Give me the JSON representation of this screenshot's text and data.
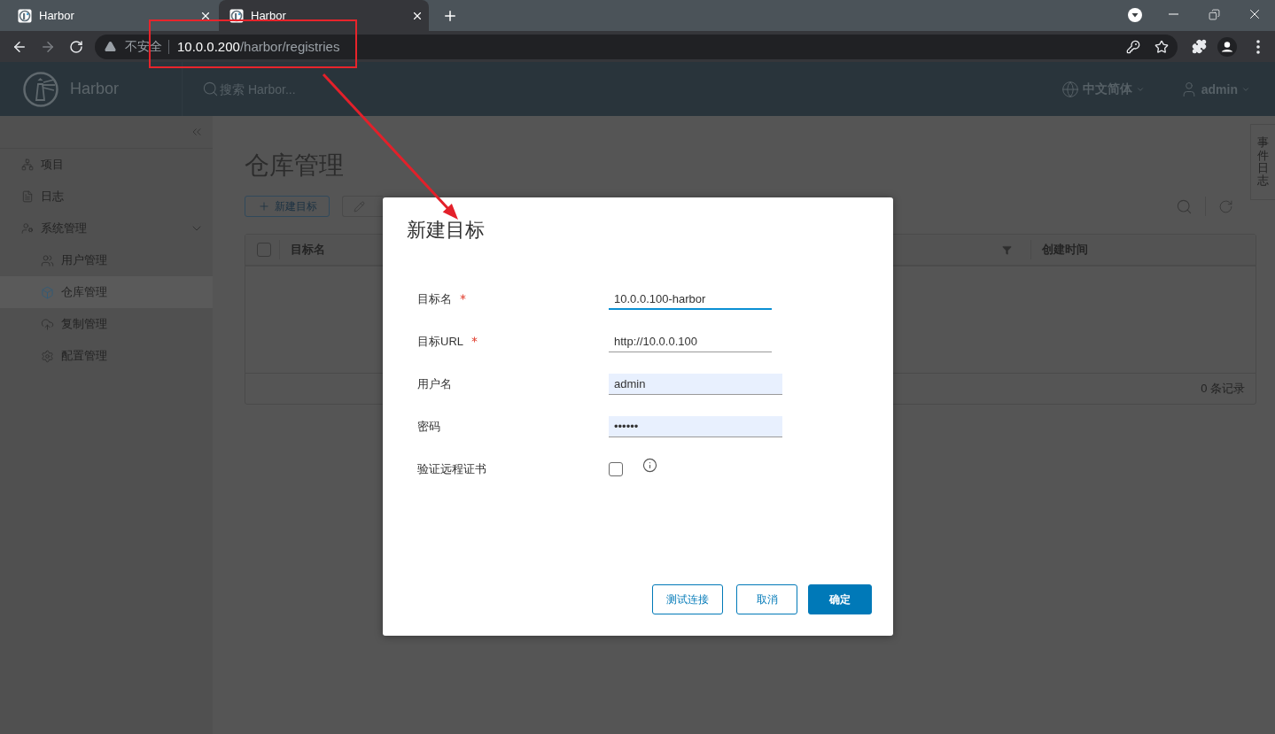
{
  "browser": {
    "tabs": [
      {
        "title": "Harbor",
        "selected": false
      },
      {
        "title": "Harbor",
        "selected": true
      }
    ],
    "address": {
      "security": "不安全",
      "host": "10.0.0.200",
      "path": "/harbor/registries"
    }
  },
  "header": {
    "brand": "Harbor",
    "search": {
      "placeholder": "搜索 Harbor..."
    },
    "language": "中文简体",
    "user": "admin"
  },
  "sidebar": {
    "items": [
      {
        "label": "项目",
        "selected": false
      },
      {
        "label": "日志",
        "selected": false
      },
      {
        "label": "系统管理",
        "selected": false,
        "expanded": true,
        "children": [
          {
            "label": "用户管理",
            "selected": false
          },
          {
            "label": "仓库管理",
            "selected": true
          },
          {
            "label": "复制管理",
            "selected": false
          },
          {
            "label": "配置管理",
            "selected": false
          }
        ]
      }
    ]
  },
  "page": {
    "title": "仓库管理",
    "new_button": "新建目标"
  },
  "table": {
    "select_all": {
      "checked": false
    },
    "columns": [
      {
        "label": "目标名"
      },
      {
        "label": "创建时间"
      }
    ],
    "footer": "0 条记录"
  },
  "event_log_tab": "事件日志",
  "dialog": {
    "title": "新建目标",
    "fields": [
      {
        "label": "目标名",
        "required": true,
        "kind": "text",
        "value": "10.0.0.100-harbor",
        "focused": true,
        "autofilled": false
      },
      {
        "label": "目标URL",
        "required": true,
        "kind": "text",
        "value": "http://10.0.0.100",
        "focused": false,
        "autofilled": false
      },
      {
        "label": "用户名",
        "required": false,
        "kind": "text",
        "value": "admin",
        "focused": false,
        "autofilled": true
      },
      {
        "label": "密码",
        "required": false,
        "kind": "text",
        "value": "••••••",
        "focused": false,
        "autofilled": true
      },
      {
        "label": "验证远程证书",
        "required": false,
        "kind": "checkbox",
        "checked": false
      }
    ],
    "buttons": [
      {
        "label": "测试连接",
        "kind": "outline"
      },
      {
        "label": "取消",
        "kind": "outline"
      },
      {
        "label": "确定",
        "kind": "primary"
      }
    ]
  }
}
